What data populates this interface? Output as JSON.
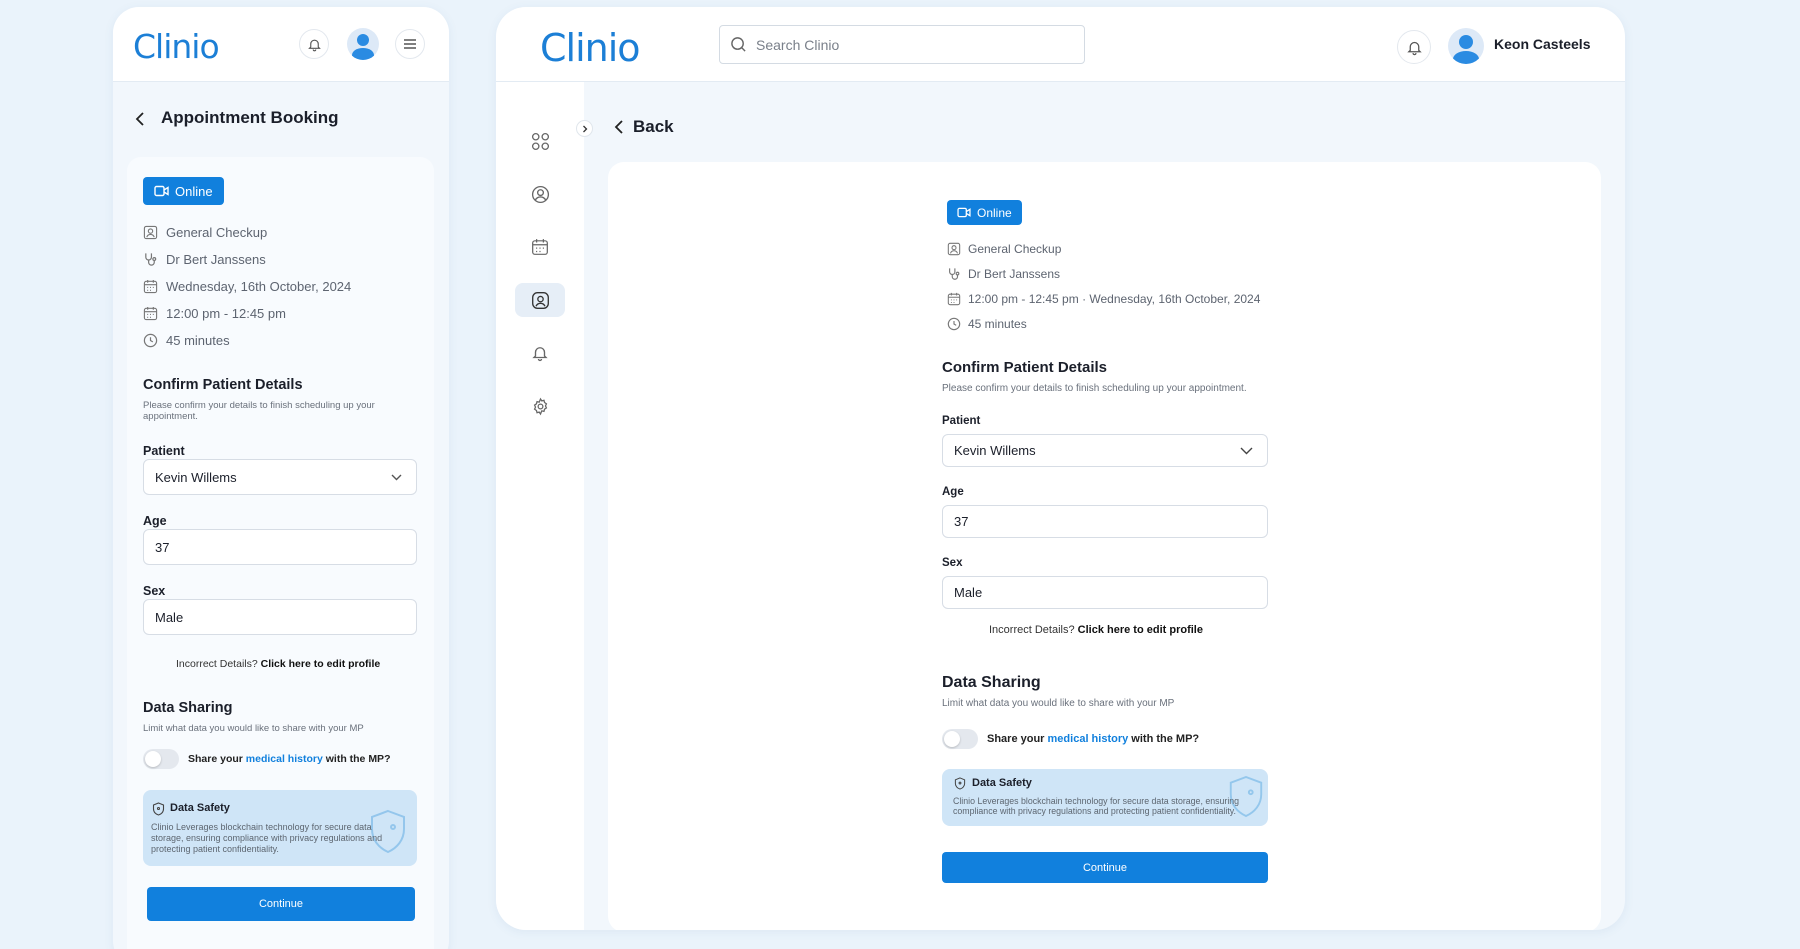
{
  "brand": {
    "name": "Clinio",
    "accent": "#1180dd"
  },
  "mobile": {
    "page_title": "Appointment Booking",
    "appointment": {
      "mode": "Online",
      "type": "General Checkup",
      "doctor": "Dr Bert Janssens",
      "date": "Wednesday, 16th October, 2024",
      "time": "12:00 pm - 12:45 pm",
      "duration": "45 minutes"
    },
    "confirm": {
      "title": "Confirm Patient Details",
      "subtitle_line1": "Please confirm your details to finish scheduling up your",
      "subtitle_line2": "appointment."
    },
    "form": {
      "patient_label": "Patient",
      "patient_value": "Kevin Willems",
      "age_label": "Age",
      "age_value": "37",
      "sex_label": "Sex",
      "sex_value": "Male"
    },
    "incorrect": {
      "text": "Incorrect Details?",
      "link": "Click here to edit profile"
    },
    "sharing": {
      "title": "Data Sharing",
      "subtitle": "Limit what data you would like to share with your MP",
      "toggle_pre": "Share your",
      "toggle_link": "medical history",
      "toggle_post": "with the MP?",
      "toggle_on": false
    },
    "safety": {
      "title": "Data Safety",
      "line1": "Clinio Leverages blockchain technology for secure data",
      "line2": "storage, ensuring compliance with privacy regulations and",
      "line3": "protecting patient confidentiality."
    },
    "continue_label": "Continue"
  },
  "desktop": {
    "search_placeholder": "Search Clinio",
    "user_name": "Keon Casteels",
    "back_label": "Back",
    "sidebar": [
      "grid-icon",
      "user-circle-icon",
      "calendar-icon",
      "profile-icon",
      "bell-icon",
      "gear-icon"
    ],
    "sidebar_active": 3,
    "appointment": {
      "mode": "Online",
      "type": "General Checkup",
      "doctor": "Dr Bert Janssens",
      "time_date": "12:00 pm - 12:45 pm  ·  Wednesday, 16th October, 2024",
      "duration": "45 minutes"
    },
    "confirm": {
      "title": "Confirm Patient Details",
      "subtitle": "Please confirm your details to finish scheduling up your appointment."
    },
    "form": {
      "patient_label": "Patient",
      "patient_value": "Kevin Willems",
      "age_label": "Age",
      "age_value": "37",
      "sex_label": "Sex",
      "sex_value": "Male"
    },
    "incorrect": {
      "text": "Incorrect Details?",
      "link": "Click here to edit profile"
    },
    "sharing": {
      "title": "Data Sharing",
      "subtitle": "Limit what data you would like to share with your MP",
      "toggle_pre": "Share your",
      "toggle_link": "medical history",
      "toggle_post": "with the MP?",
      "toggle_on": false
    },
    "safety": {
      "title": "Data Safety",
      "line1": "Clinio Leverages blockchain technology for secure data storage, ensuring",
      "line2": "compliance with privacy regulations and protecting patient confidentiality."
    },
    "continue_label": "Continue"
  }
}
